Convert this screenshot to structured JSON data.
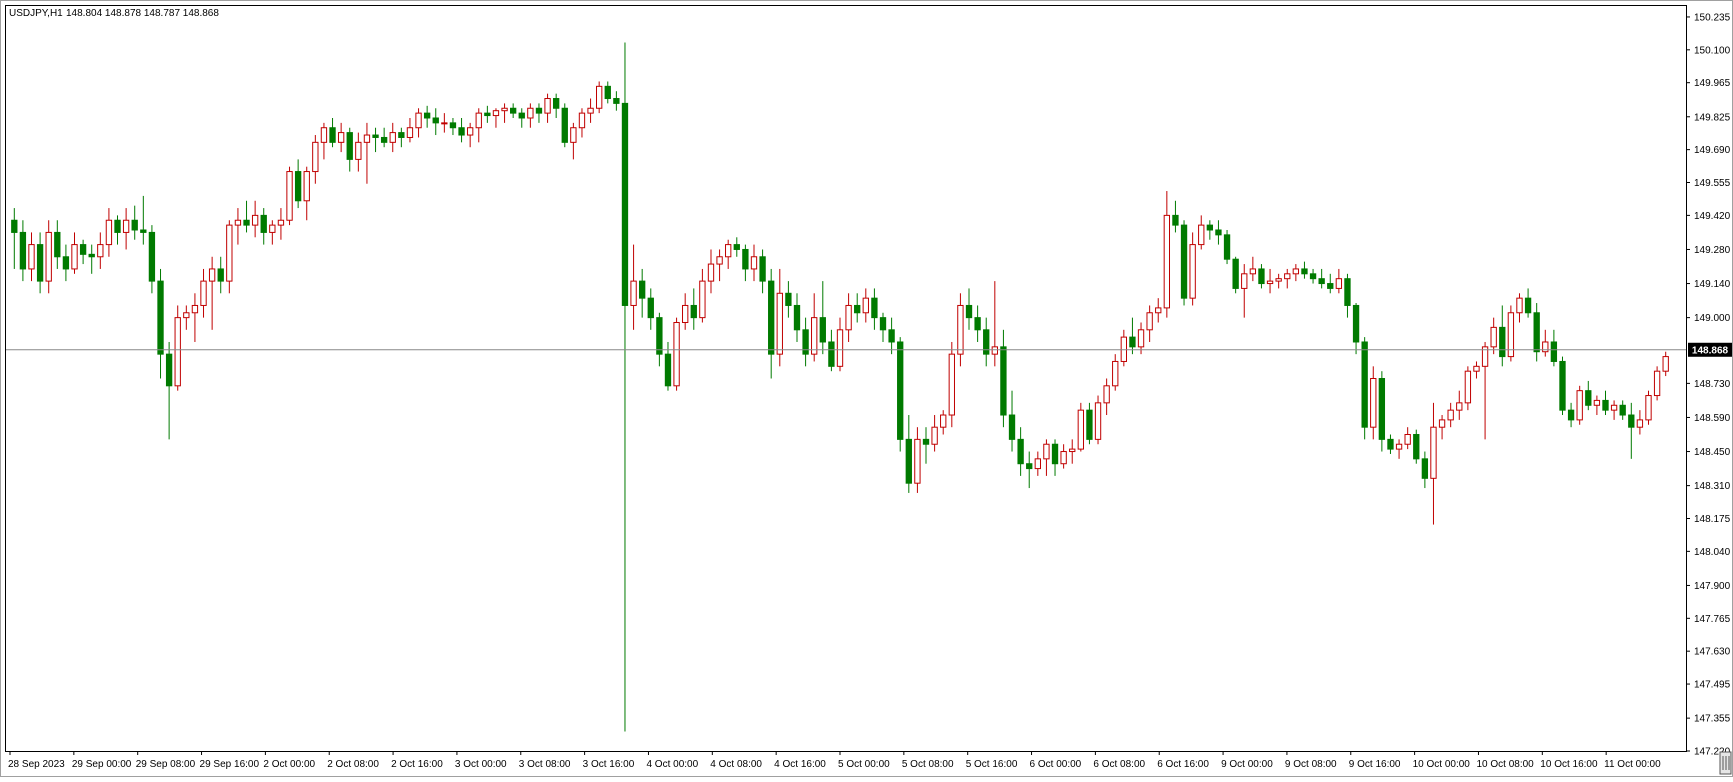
{
  "header": {
    "symbol": "USDJPY,H1",
    "ohlc": "148.804 148.878 148.787 148.868"
  },
  "current_price_label": "148.868",
  "colors": {
    "bull": "#c00000",
    "bear": "#007a00",
    "grid_frame": "#000000",
    "price_line": "#888888",
    "price_tag_bg": "#000000",
    "price_tag_text": "#ffffff"
  },
  "chart_data": {
    "type": "candlestick",
    "title": "USDJPY,H1",
    "ylim": [
      147.22,
      150.28
    ],
    "y_ticks": [
      "150.235",
      "150.100",
      "149.965",
      "149.825",
      "149.690",
      "149.555",
      "149.420",
      "149.280",
      "149.140",
      "149.000",
      "148.730",
      "148.590",
      "148.450",
      "148.310",
      "148.175",
      "148.040",
      "147.900",
      "147.765",
      "147.630",
      "147.495",
      "147.355",
      "147.220"
    ],
    "x_ticks": [
      "28 Sep 2023",
      "29 Sep 00:00",
      "29 Sep 08:00",
      "29 Sep 16:00",
      "2 Oct 00:00",
      "2 Oct 08:00",
      "2 Oct 16:00",
      "3 Oct 00:00",
      "3 Oct 08:00",
      "3 Oct 16:00",
      "4 Oct 00:00",
      "4 Oct 08:00",
      "4 Oct 16:00",
      "5 Oct 00:00",
      "5 Oct 08:00",
      "5 Oct 16:00",
      "6 Oct 00:00",
      "6 Oct 08:00",
      "6 Oct 16:00",
      "9 Oct 00:00",
      "9 Oct 08:00",
      "9 Oct 16:00",
      "10 Oct 00:00",
      "10 Oct 08:00",
      "10 Oct 16:00",
      "11 Oct 00:00"
    ],
    "last_price": 148.868,
    "grid": false,
    "candles": [
      [
        149.4,
        149.45,
        149.2,
        149.35
      ],
      [
        149.35,
        149.4,
        149.15,
        149.2
      ],
      [
        149.2,
        149.35,
        149.15,
        149.3
      ],
      [
        149.3,
        149.35,
        149.1,
        149.15
      ],
      [
        149.15,
        149.4,
        149.1,
        149.35
      ],
      [
        149.35,
        149.4,
        149.2,
        149.25
      ],
      [
        149.25,
        149.3,
        149.15,
        149.2
      ],
      [
        149.2,
        149.35,
        149.18,
        149.3
      ],
      [
        149.3,
        149.32,
        149.22,
        149.26
      ],
      [
        149.26,
        149.3,
        149.18,
        149.25
      ],
      [
        149.25,
        149.35,
        149.2,
        149.3
      ],
      [
        149.3,
        149.45,
        149.25,
        149.4
      ],
      [
        149.4,
        149.42,
        149.3,
        149.35
      ],
      [
        149.35,
        149.45,
        149.28,
        149.4
      ],
      [
        149.4,
        149.46,
        149.32,
        149.36
      ],
      [
        149.36,
        149.5,
        149.3,
        149.35
      ],
      [
        149.35,
        149.38,
        149.1,
        149.15
      ],
      [
        149.15,
        149.2,
        148.75,
        148.85
      ],
      [
        148.85,
        148.9,
        148.5,
        148.72
      ],
      [
        148.72,
        149.05,
        148.7,
        149.0
      ],
      [
        149.0,
        149.05,
        148.95,
        149.02
      ],
      [
        149.02,
        149.1,
        148.9,
        149.05
      ],
      [
        149.05,
        149.2,
        149.0,
        149.15
      ],
      [
        149.15,
        149.25,
        148.95,
        149.2
      ],
      [
        149.2,
        149.25,
        149.1,
        149.15
      ],
      [
        149.15,
        149.4,
        149.1,
        149.38
      ],
      [
        149.38,
        149.45,
        149.3,
        149.4
      ],
      [
        149.4,
        149.48,
        149.35,
        149.38
      ],
      [
        149.38,
        149.48,
        149.33,
        149.42
      ],
      [
        149.42,
        149.45,
        149.3,
        149.35
      ],
      [
        149.35,
        149.4,
        149.3,
        149.38
      ],
      [
        149.38,
        149.45,
        149.32,
        149.4
      ],
      [
        149.4,
        149.62,
        149.38,
        149.6
      ],
      [
        149.6,
        149.65,
        149.45,
        149.48
      ],
      [
        149.48,
        149.62,
        149.4,
        149.6
      ],
      [
        149.6,
        149.75,
        149.55,
        149.72
      ],
      [
        149.72,
        149.8,
        149.65,
        149.78
      ],
      [
        149.78,
        149.82,
        149.7,
        149.72
      ],
      [
        149.72,
        149.8,
        149.68,
        149.76
      ],
      [
        149.76,
        149.78,
        149.6,
        149.65
      ],
      [
        149.65,
        149.76,
        149.6,
        149.72
      ],
      [
        149.72,
        149.8,
        149.55,
        149.75
      ],
      [
        149.75,
        149.78,
        149.68,
        149.74
      ],
      [
        149.74,
        149.78,
        149.7,
        149.72
      ],
      [
        149.72,
        149.8,
        149.68,
        149.76
      ],
      [
        149.76,
        149.78,
        149.7,
        149.74
      ],
      [
        149.74,
        149.82,
        149.72,
        149.78
      ],
      [
        149.78,
        149.86,
        149.74,
        149.84
      ],
      [
        149.84,
        149.87,
        149.78,
        149.82
      ],
      [
        149.82,
        149.86,
        149.75,
        149.8
      ],
      [
        149.8,
        149.84,
        149.76,
        149.8
      ],
      [
        149.8,
        149.82,
        149.75,
        149.78
      ],
      [
        149.78,
        149.82,
        149.72,
        149.75
      ],
      [
        149.75,
        149.8,
        149.7,
        149.78
      ],
      [
        149.78,
        149.86,
        149.72,
        149.84
      ],
      [
        149.84,
        149.87,
        149.8,
        149.83
      ],
      [
        149.83,
        149.86,
        149.78,
        149.85
      ],
      [
        149.85,
        149.88,
        149.8,
        149.86
      ],
      [
        149.86,
        149.88,
        149.82,
        149.84
      ],
      [
        149.84,
        149.86,
        149.78,
        149.82
      ],
      [
        149.82,
        149.88,
        149.78,
        149.86
      ],
      [
        149.86,
        149.88,
        149.8,
        149.84
      ],
      [
        149.84,
        149.92,
        149.8,
        149.9
      ],
      [
        149.9,
        149.92,
        149.82,
        149.86
      ],
      [
        149.86,
        149.88,
        149.7,
        149.72
      ],
      [
        149.72,
        149.8,
        149.65,
        149.78
      ],
      [
        149.78,
        149.86,
        149.74,
        149.84
      ],
      [
        149.84,
        149.9,
        149.8,
        149.86
      ],
      [
        149.86,
        149.97,
        149.84,
        149.95
      ],
      [
        149.95,
        149.97,
        149.88,
        149.9
      ],
      [
        149.9,
        149.93,
        149.85,
        149.88
      ],
      [
        149.88,
        150.13,
        147.3,
        149.05
      ],
      [
        149.05,
        149.3,
        148.95,
        149.15
      ],
      [
        149.15,
        149.2,
        149.0,
        149.08
      ],
      [
        149.08,
        149.12,
        148.95,
        149.0
      ],
      [
        149.0,
        149.02,
        148.8,
        148.85
      ],
      [
        148.85,
        148.9,
        148.7,
        148.72
      ],
      [
        148.72,
        149.0,
        148.7,
        148.98
      ],
      [
        148.98,
        149.1,
        148.95,
        149.05
      ],
      [
        149.05,
        149.12,
        148.95,
        149.0
      ],
      [
        149.0,
        149.2,
        148.98,
        149.15
      ],
      [
        149.15,
        149.28,
        149.1,
        149.22
      ],
      [
        149.22,
        149.28,
        149.15,
        149.25
      ],
      [
        149.25,
        149.32,
        149.2,
        149.3
      ],
      [
        149.3,
        149.33,
        149.25,
        149.28
      ],
      [
        149.28,
        149.3,
        149.15,
        149.2
      ],
      [
        149.2,
        149.3,
        149.15,
        149.25
      ],
      [
        149.25,
        149.28,
        149.1,
        149.15
      ],
      [
        149.15,
        149.2,
        148.75,
        148.85
      ],
      [
        148.85,
        149.2,
        148.8,
        149.1
      ],
      [
        149.1,
        149.15,
        149.0,
        149.05
      ],
      [
        149.05,
        149.1,
        148.9,
        148.95
      ],
      [
        148.95,
        149.0,
        148.8,
        148.85
      ],
      [
        148.85,
        149.1,
        148.82,
        149.0
      ],
      [
        149.0,
        149.15,
        148.85,
        148.9
      ],
      [
        148.9,
        148.95,
        148.78,
        148.8
      ],
      [
        148.8,
        149.0,
        148.78,
        148.95
      ],
      [
        148.95,
        149.1,
        148.9,
        149.05
      ],
      [
        149.05,
        149.1,
        148.98,
        149.02
      ],
      [
        149.02,
        149.12,
        148.98,
        149.08
      ],
      [
        149.08,
        149.12,
        148.95,
        149.0
      ],
      [
        149.0,
        149.02,
        148.9,
        148.95
      ],
      [
        148.95,
        149.0,
        148.85,
        148.9
      ],
      [
        148.9,
        148.92,
        148.45,
        148.5
      ],
      [
        148.5,
        148.6,
        148.28,
        148.32
      ],
      [
        148.32,
        148.55,
        148.28,
        148.5
      ],
      [
        148.5,
        148.55,
        148.4,
        148.48
      ],
      [
        148.48,
        148.6,
        148.45,
        148.55
      ],
      [
        148.55,
        148.62,
        148.52,
        148.6
      ],
      [
        148.6,
        148.9,
        148.55,
        148.85
      ],
      [
        148.85,
        149.1,
        148.8,
        149.05
      ],
      [
        149.05,
        149.12,
        148.95,
        149.0
      ],
      [
        149.0,
        149.05,
        148.9,
        148.95
      ],
      [
        148.95,
        149.0,
        148.8,
        148.85
      ],
      [
        148.85,
        149.15,
        148.8,
        148.88
      ],
      [
        148.88,
        148.95,
        148.55,
        148.6
      ],
      [
        148.6,
        148.7,
        148.45,
        148.5
      ],
      [
        148.5,
        148.55,
        148.35,
        148.4
      ],
      [
        148.4,
        148.45,
        148.3,
        148.38
      ],
      [
        148.38,
        148.45,
        148.35,
        148.42
      ],
      [
        148.42,
        148.5,
        148.35,
        148.48
      ],
      [
        148.48,
        148.5,
        148.35,
        148.4
      ],
      [
        148.4,
        148.48,
        148.38,
        148.45
      ],
      [
        148.45,
        148.5,
        148.4,
        148.46
      ],
      [
        148.46,
        148.65,
        148.45,
        148.62
      ],
      [
        148.62,
        148.65,
        148.48,
        148.5
      ],
      [
        148.5,
        148.68,
        148.48,
        148.65
      ],
      [
        148.65,
        148.75,
        148.6,
        148.72
      ],
      [
        148.72,
        148.85,
        148.7,
        148.82
      ],
      [
        148.82,
        148.95,
        148.8,
        148.92
      ],
      [
        148.92,
        149.0,
        148.85,
        148.88
      ],
      [
        148.88,
        148.98,
        148.85,
        148.95
      ],
      [
        148.95,
        149.05,
        148.9,
        149.02
      ],
      [
        149.02,
        149.08,
        148.98,
        149.04
      ],
      [
        149.04,
        149.52,
        149.0,
        149.42
      ],
      [
        149.42,
        149.48,
        149.35,
        149.38
      ],
      [
        149.38,
        149.4,
        149.05,
        149.08
      ],
      [
        149.08,
        149.35,
        149.05,
        149.3
      ],
      [
        149.3,
        149.42,
        149.28,
        149.38
      ],
      [
        149.38,
        149.4,
        149.32,
        149.36
      ],
      [
        149.36,
        149.4,
        149.3,
        149.34
      ],
      [
        149.34,
        149.36,
        149.22,
        149.24
      ],
      [
        149.24,
        149.25,
        149.1,
        149.12
      ],
      [
        149.12,
        149.22,
        149.0,
        149.18
      ],
      [
        149.18,
        149.25,
        149.15,
        149.2
      ],
      [
        149.2,
        149.22,
        149.12,
        149.14
      ],
      [
        149.14,
        149.2,
        149.1,
        149.15
      ],
      [
        149.15,
        149.18,
        149.12,
        149.16
      ],
      [
        149.16,
        149.2,
        149.12,
        149.18
      ],
      [
        149.18,
        149.22,
        149.15,
        149.2
      ],
      [
        149.2,
        149.23,
        149.16,
        149.18
      ],
      [
        149.18,
        149.2,
        149.14,
        149.16
      ],
      [
        149.16,
        149.2,
        149.12,
        149.14
      ],
      [
        149.14,
        149.18,
        149.1,
        149.12
      ],
      [
        149.12,
        149.2,
        149.1,
        149.16
      ],
      [
        149.16,
        149.18,
        149.0,
        149.05
      ],
      [
        149.05,
        149.06,
        148.85,
        148.9
      ],
      [
        148.9,
        148.92,
        148.5,
        148.55
      ],
      [
        148.55,
        148.8,
        148.5,
        148.75
      ],
      [
        148.75,
        148.78,
        148.45,
        148.5
      ],
      [
        148.5,
        148.52,
        148.44,
        148.46
      ],
      [
        148.46,
        148.5,
        148.42,
        148.48
      ],
      [
        148.48,
        148.55,
        148.46,
        148.52
      ],
      [
        148.52,
        148.54,
        148.4,
        148.42
      ],
      [
        148.42,
        148.45,
        148.3,
        148.34
      ],
      [
        148.34,
        148.65,
        148.15,
        148.55
      ],
      [
        148.55,
        148.6,
        148.5,
        148.58
      ],
      [
        148.58,
        148.65,
        148.55,
        148.62
      ],
      [
        148.62,
        148.7,
        148.58,
        148.65
      ],
      [
        148.65,
        148.8,
        148.62,
        148.78
      ],
      [
        148.78,
        148.82,
        148.75,
        148.8
      ],
      [
        148.8,
        148.9,
        148.5,
        148.88
      ],
      [
        148.88,
        149.0,
        148.85,
        148.96
      ],
      [
        148.96,
        149.05,
        148.8,
        148.84
      ],
      [
        148.84,
        149.05,
        148.82,
        149.02
      ],
      [
        149.02,
        149.1,
        148.98,
        149.08
      ],
      [
        149.08,
        149.12,
        149.0,
        149.02
      ],
      [
        149.02,
        149.06,
        148.82,
        148.86
      ],
      [
        148.86,
        148.95,
        148.84,
        148.9
      ],
      [
        148.9,
        148.95,
        148.8,
        148.82
      ],
      [
        148.82,
        148.84,
        148.6,
        148.62
      ],
      [
        148.62,
        148.65,
        148.55,
        148.58
      ],
      [
        148.58,
        148.72,
        148.56,
        148.7
      ],
      [
        148.7,
        148.74,
        148.62,
        148.64
      ],
      [
        148.64,
        148.68,
        148.6,
        148.66
      ],
      [
        148.66,
        148.7,
        148.6,
        148.62
      ],
      [
        148.62,
        148.66,
        148.58,
        148.64
      ],
      [
        148.64,
        148.66,
        148.58,
        148.6
      ],
      [
        148.6,
        148.65,
        148.42,
        148.55
      ],
      [
        148.55,
        148.62,
        148.52,
        148.58
      ],
      [
        148.58,
        148.7,
        148.56,
        148.68
      ],
      [
        148.68,
        148.8,
        148.66,
        148.78
      ],
      [
        148.78,
        148.86,
        148.76,
        148.84
      ]
    ]
  }
}
